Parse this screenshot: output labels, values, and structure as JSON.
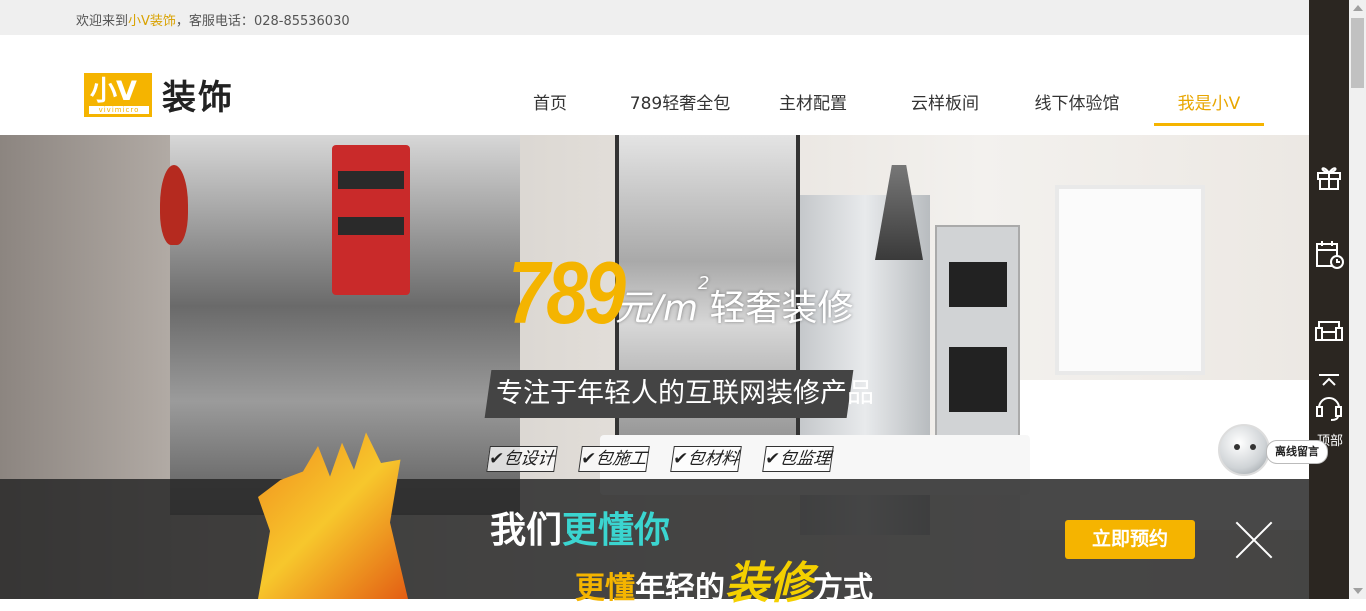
{
  "topbar": {
    "welcome": "欢迎来到",
    "brand": "小V装饰",
    "phone_label": "，客服电话：",
    "phone": "028-85536030"
  },
  "logo": {
    "mark": "小V",
    "sub": "vivimicro",
    "name": "装饰"
  },
  "nav": {
    "items": [
      {
        "label": "首页"
      },
      {
        "label": "789轻奢全包"
      },
      {
        "label": "主材配置"
      },
      {
        "label": "云样板间"
      },
      {
        "label": "线下体验馆"
      },
      {
        "label": "我是小V"
      }
    ],
    "active_index": 5
  },
  "hero": {
    "price": "789",
    "unit": "元/m",
    "unit_sup": "2",
    "headline": "轻奢装修",
    "slogan": "专注于年轻人的互联网装修产品",
    "badges": [
      "✔包设计",
      "✔包施工",
      "✔包材料",
      "✔包监理"
    ]
  },
  "promo": {
    "line1_a": "我们",
    "line1_b": "更懂你",
    "line2_a": "更懂",
    "line2_b": "年轻的",
    "line2_c": "装修",
    "line2_d": "方式",
    "book_button": "立即预约"
  },
  "sidebar": {
    "top_label": "顶部",
    "icons": [
      "gift-icon",
      "calendar-icon",
      "sofa-icon",
      "headset-icon"
    ]
  },
  "chat": {
    "label": "离线留言"
  },
  "colors": {
    "accent": "#f5b400",
    "sidebar_bg": "#2b2621",
    "promo_highlight": "#3bd5d0"
  }
}
